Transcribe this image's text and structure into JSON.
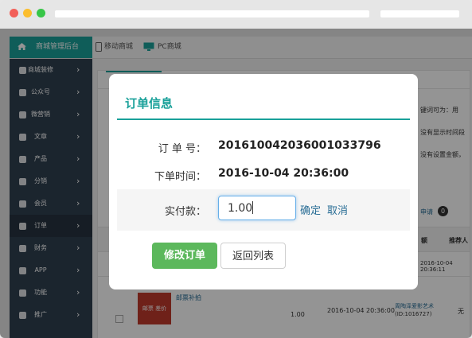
{
  "app": {
    "brand": "商城管理后台",
    "nav": [
      "移动商城",
      "PC商城"
    ]
  },
  "sidebar": {
    "items": [
      {
        "label": "商城装修",
        "icon": "mobile-icon"
      },
      {
        "label": "公众号",
        "icon": "wechat-icon"
      },
      {
        "label": "微营销",
        "icon": "book-icon"
      },
      {
        "label": "文章",
        "icon": "document-icon"
      },
      {
        "label": "产品",
        "icon": "cubes-icon"
      },
      {
        "label": "分销",
        "icon": "share-icon"
      },
      {
        "label": "会员",
        "icon": "user-icon"
      },
      {
        "label": "订单",
        "icon": "calendar-icon"
      },
      {
        "label": "财务",
        "icon": "money-icon"
      },
      {
        "label": "APP",
        "icon": "apple-icon"
      },
      {
        "label": "功能",
        "icon": "inbox-icon"
      },
      {
        "label": "推广",
        "icon": "bullhorn-icon"
      }
    ]
  },
  "background": {
    "right_notes": [
      "键词可为：用",
      "没有显示时间段",
      "没有设置金额，"
    ],
    "apply_link": "申请",
    "apply_count": "0",
    "table_headers": [
      "额",
      "推荐人"
    ],
    "row1_time": "2016-10-04 20:36:11",
    "row2": {
      "product": "邮票补拍",
      "amount": "1.00",
      "time": "2016-10-04 20:36:00",
      "buyer": "周陶泽爱影艺术",
      "buyer_id": "(ID:1016727)",
      "referrer": "无",
      "thumb_text": "邮票 差价"
    }
  },
  "modal": {
    "title": "订单信息",
    "order_no_label": "订 单 号：",
    "order_no": "20161004203600103379​6",
    "order_time_label": "下单时间：",
    "order_time": "2016-10-04 20:36:00",
    "paid_label": "实付款：",
    "paid_value": "1.00",
    "confirm": "确定",
    "cancel": "取消",
    "modify_button": "修改订单",
    "back_button": "返回列表"
  },
  "colors": {
    "accent": "#1aa19a",
    "sidebar_bg": "#2f4050",
    "success": "#5cb85c",
    "link": "#2a6e96"
  }
}
